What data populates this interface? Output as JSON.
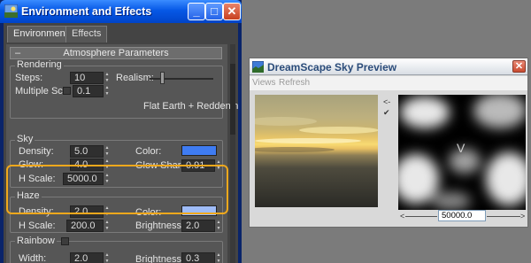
{
  "env_window": {
    "title": "Environment and Effects",
    "tabs": [
      {
        "label": "Environment",
        "active": true
      },
      {
        "label": "Effects",
        "active": false
      }
    ],
    "rollout_title": "Atmosphere Parameters",
    "rendering": {
      "group_label": "Rendering",
      "steps_label": "Steps:",
      "steps_value": "10",
      "multiple_label": "Multiple Sc",
      "multiple_value": "0.1",
      "realism_label": "Realism:",
      "realism_level": 0.2,
      "mode_text": "Flat Earth + Reddening"
    },
    "sky": {
      "group_label": "Sky",
      "density_label": "Density:",
      "density_value": "5.0",
      "glow_label": "Glow:",
      "glow_value": "4.0",
      "hscale_label": "H Scale:",
      "hscale_value": "5000.0",
      "color_label": "Color:",
      "color": "#3f7cf2",
      "glow_sharp_label": "Glow Sharp:",
      "glow_sharp_value": "0.91"
    },
    "haze": {
      "group_label": "Haze",
      "density_label": "Density:",
      "density_value": "2.0",
      "hscale_label": "H Scale:",
      "hscale_value": "200.0",
      "color_label": "Color:",
      "color": "#9fbcf8",
      "brightness_label": "Brightness:",
      "brightness_value": "2.0"
    },
    "rainbow": {
      "group_label": "Rainbow",
      "width_label": "Width:",
      "width_value": "2.0",
      "brightness_label": "Brightness:",
      "brightness_value": "0.3"
    },
    "highlight_color": "#f0a81c"
  },
  "preview_window": {
    "title": "DreamScape Sky Preview",
    "menu": [
      "Views",
      "Refresh"
    ],
    "side_arrow": "<-",
    "side_check": "✔",
    "cloud_marker": "V",
    "ruler_value": "50000.0",
    "ruler_left_arrow": "<",
    "ruler_right_arrow": ">"
  },
  "icons": {
    "window_icon": "sky-icon",
    "minimize": "minimize-icon",
    "maximize": "maximize-icon",
    "close": "close-icon"
  },
  "controls": {
    "minimize_glyph": "_",
    "maximize_glyph": "□",
    "close_glyph": "✕",
    "rollout_minus": "–"
  }
}
